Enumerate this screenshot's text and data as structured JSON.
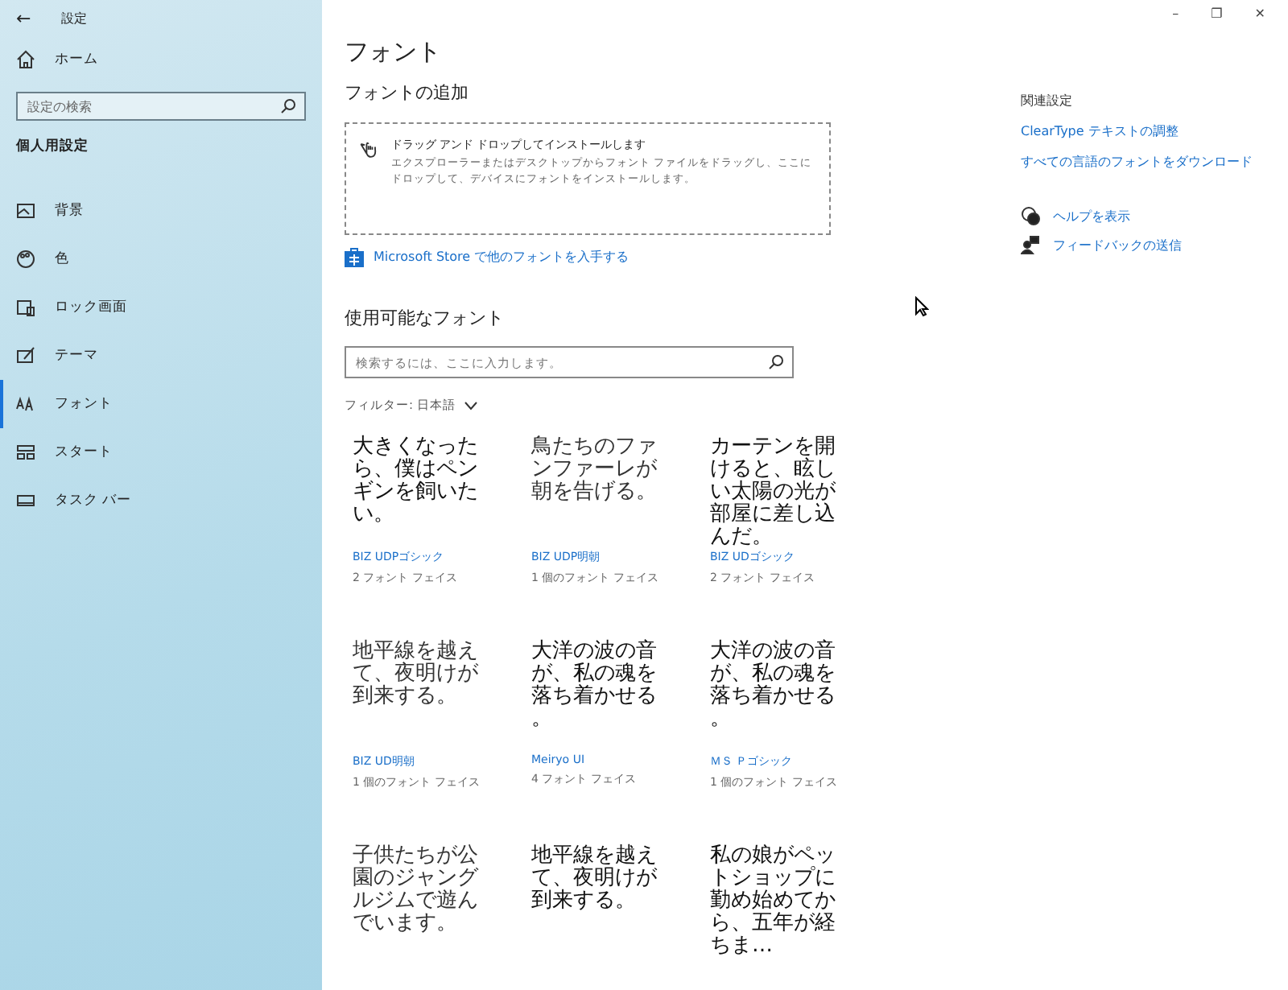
{
  "window": {
    "title": "設定",
    "back": "←",
    "controls": [
      "–",
      "❐",
      "✕"
    ]
  },
  "sidebar": {
    "home": "ホーム",
    "search": {
      "placeholder": "設定の検索"
    },
    "section": "個人用設定",
    "items": [
      {
        "label": "背景",
        "selected": false
      },
      {
        "label": "色",
        "selected": false
      },
      {
        "label": "ロック画面",
        "selected": false
      },
      {
        "label": "テーマ",
        "selected": false
      },
      {
        "label": "フォント",
        "selected": true
      },
      {
        "label": "スタート",
        "selected": false
      },
      {
        "label": "タスク バー",
        "selected": false
      }
    ]
  },
  "main": {
    "title": "フォント",
    "add_heading": "フォントの追加",
    "drop_zone": {
      "title": "ドラッグ アンド ドロップしてインストールします",
      "description": "エクスプローラーまたはデスクトップからフォント ファイルをドラッグし、ここにドロップして、デバイスにフォントをインストールします。"
    },
    "store_link": "Microsoft Store で他のフォントを入手する",
    "available_heading": "使用可能なフォント",
    "search": {
      "placeholder": "検索するには、ここに入力します。"
    },
    "filter": "フィルター: 日本語",
    "fonts": [
      {
        "sample": "大きくなったら、僕はペンギンを飼いたい。",
        "name": "BIZ UDPゴシック",
        "faces": "2 フォント フェイス",
        "kind": "gothic"
      },
      {
        "sample": "鳥たちのファンファーレが朝を告げる。",
        "name": "BIZ UDP明朝",
        "faces": "1 個のフォント フェイス",
        "kind": "mincho"
      },
      {
        "sample": "カーテンを開けると、眩しい太陽の光が部屋に差し込んだ。",
        "name": "BIZ UDゴシック",
        "faces": "2 フォント フェイス",
        "kind": "gothic"
      },
      {
        "sample": "地平線を越えて、夜明けが到来する。",
        "name": "BIZ UD明朝",
        "faces": "1 個のフォント フェイス",
        "kind": "mincho"
      },
      {
        "sample": "大洋の波の音が、私の魂を落ち着かせる。",
        "name": "Meiryo UI",
        "faces": "4 フォント フェイス",
        "kind": "gothic"
      },
      {
        "sample": "大洋の波の音が、私の魂を落ち着かせる。",
        "name": "ＭＳ Ｐゴシック",
        "faces": "1 個のフォント フェイス",
        "kind": "gothic"
      },
      {
        "sample": "子供たちが公園のジャングルジムで遊んでいます。",
        "kind": "mincho"
      },
      {
        "sample": "地平線を越えて、夜明けが到来する。",
        "kind": "gothic"
      },
      {
        "sample": "私の娘がペットショップに勤め始めてから、五年が経ちま…",
        "kind": "gothic"
      }
    ]
  },
  "related": {
    "heading": "関連設定",
    "links": [
      "ClearType テキストの調整",
      "すべての言語のフォントをダウンロード"
    ],
    "help": "ヘルプを表示",
    "feedback": "フィードバックの送信"
  }
}
